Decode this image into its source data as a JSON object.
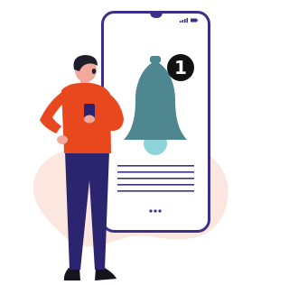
{
  "notification": {
    "badge_count": "1",
    "icon": "bell-icon"
  },
  "colors": {
    "phone_frame": "#3d2e88",
    "bell": "#4e8790",
    "bell_clapper": "#8dd3da",
    "badge": "#111111",
    "badge_text": "#ffffff",
    "text_lines": "#3d2e88",
    "shirt": "#e9471e",
    "trousers": "#2b2570",
    "skin": "#f0a99b",
    "hair": "#1d1d2b",
    "blob": "#fbe6e0"
  }
}
